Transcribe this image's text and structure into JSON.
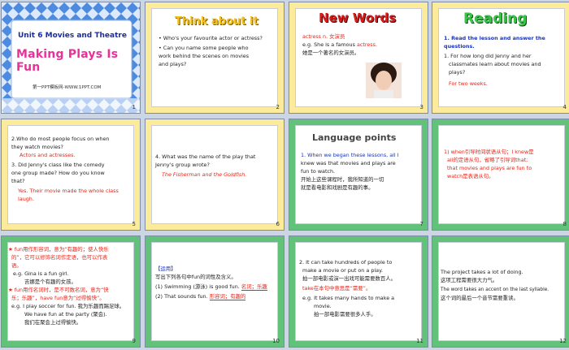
{
  "slides": [
    {
      "num": "1",
      "unit": "Unit 6  Movies and Theatre",
      "title": "Making Plays Is Fun",
      "footer": "第一PPT模板网-WWW.1PPT.COM"
    },
    {
      "num": "2",
      "title": "Think about it",
      "lines": [
        "• Who's your favourite  actor or actress?",
        "• Can you name some people who",
        "  work behind  the  scenes on movies",
        "  and plays?"
      ]
    },
    {
      "num": "3",
      "title": "New Words",
      "word": "actress  n.  女演员",
      "ex_prefix": "e.g. She is a famous ",
      "ex_word": "actress.",
      "ex_cn": "她是一个著名的女演员。"
    },
    {
      "num": "4",
      "title": "Reading",
      "q1": "1. Read the lesson  and answer the",
      "q1b": "   questions.",
      "q2": "1. For how long did Jenny and her",
      "q2b": "classmates learn about  movies and",
      "q2c": "plays?",
      "ans": "For two weeks."
    },
    {
      "num": "5",
      "lines": [
        "2.Who do most people focus on when",
        "   they watch movies?"
      ],
      "ans1": "Actors and actresses.",
      "lines2": [
        "3. Did Jenny's class like the comedy",
        "   one group made?  How do you know",
        "   that?"
      ],
      "ans2a": "Yes.  Their movie  made  the whole class",
      "ans2b": "laugh."
    },
    {
      "num": "6",
      "lines": [
        "4. What was the name of the play that",
        "   Jenny's group wrote?"
      ],
      "ans": "The Fisherman and the Goldfish."
    },
    {
      "num": "7",
      "title": "Language points",
      "l1a": "1. When we began  these lessons, all I",
      "l1b": "knew  was that  movies and  plays are",
      "l1c": "fun  to watch.",
      "cn1": "开始上这些课程时，我所知道的一切",
      "cn2": "就是看电影和戏剧是有趣的事。"
    },
    {
      "num": "8",
      "l1": "1) when引导时间状语从句；I knew是",
      "l2": "all的定语从句，省略了引导词that;",
      "l3": "that movies and plays are fun to",
      "l4": "watch是表语从句。"
    },
    {
      "num": "9",
      "h1": "fun用作形容词，意为“有趣的；使人快乐",
      "h1b": "的”，它可以修饰名词作定语，也可以作表",
      "h1c": "语。",
      "e1": "e.g. Gina  is a fun girl.",
      "c1": "吉娜是个有趣的女孩。",
      "h2": "fun用作名词时，是不可数名词，意为“快",
      "h2b": "乐；乐趣”，have fun意为“过得愉快”。",
      "e2": "e.g. I play  soccer for fun.  我为乐趣而踢足球。",
      "e3": "We have  fun at the party (聚会).",
      "c3": "我们在聚会上过得愉快。"
    },
    {
      "num": "10",
      "h": "【运用】",
      "p": "写出下列各句中fun的词性及含义。",
      "s1": "(1)  Swimming  (游泳) is good  fun.",
      "a1": "名词；乐趣",
      "s2": "(2)  That sounds  fun.",
      "a2": "形容词；有趣的"
    },
    {
      "num": "11",
      "l1": "2.  It can take hundreds  of people  to",
      "l2": "make a movie  or put on a play.",
      "c1": "拍一部电影或演一出戏可能需要数百人。",
      "l3": "take在本句中意思是“需要”。",
      "l4": "e.g.  It takes many  hands to make a",
      "l5": "movie.",
      "c2": "拍一部电影需要很多人手。"
    },
    {
      "num": "12",
      "l1": "The project takes a lot of doing.",
      "c1": "这项工程需要很大力气。",
      "l2": "The word  takes an accent on the last syllable.",
      "c2": "这个词的最后一个音节需要重读。"
    }
  ],
  "colors": {
    "red": "#e0261b",
    "blue": "#1c35b5",
    "navy": "#1b2a6b",
    "yellow": "#fdeb9c",
    "green": "#63c27a"
  }
}
